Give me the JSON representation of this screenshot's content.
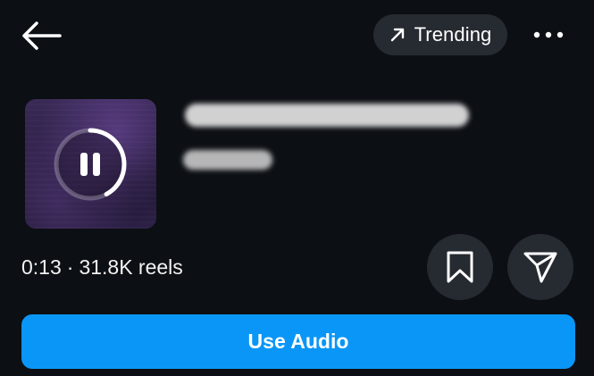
{
  "header": {
    "back_icon": "arrow-left-icon",
    "trending_icon": "arrow-up-right-icon",
    "trending_label": "Trending",
    "more_icon": "more-horizontal-icon"
  },
  "track": {
    "title": "",
    "artist": "",
    "title_blurred": true,
    "artist_blurred": true,
    "playback_state": "playing",
    "playback_icon": "pause-icon",
    "progress": 0.42
  },
  "meta": {
    "duration": "0:13",
    "separator": "·",
    "reels_count": "31.8K reels"
  },
  "actions": {
    "save_icon": "bookmark-icon",
    "share_icon": "send-icon",
    "use_audio_label": "Use Audio"
  },
  "colors": {
    "background": "#0c0f14",
    "chip_background": "#262a31",
    "primary_button": "#0a96f6",
    "text": "#ffffff"
  }
}
